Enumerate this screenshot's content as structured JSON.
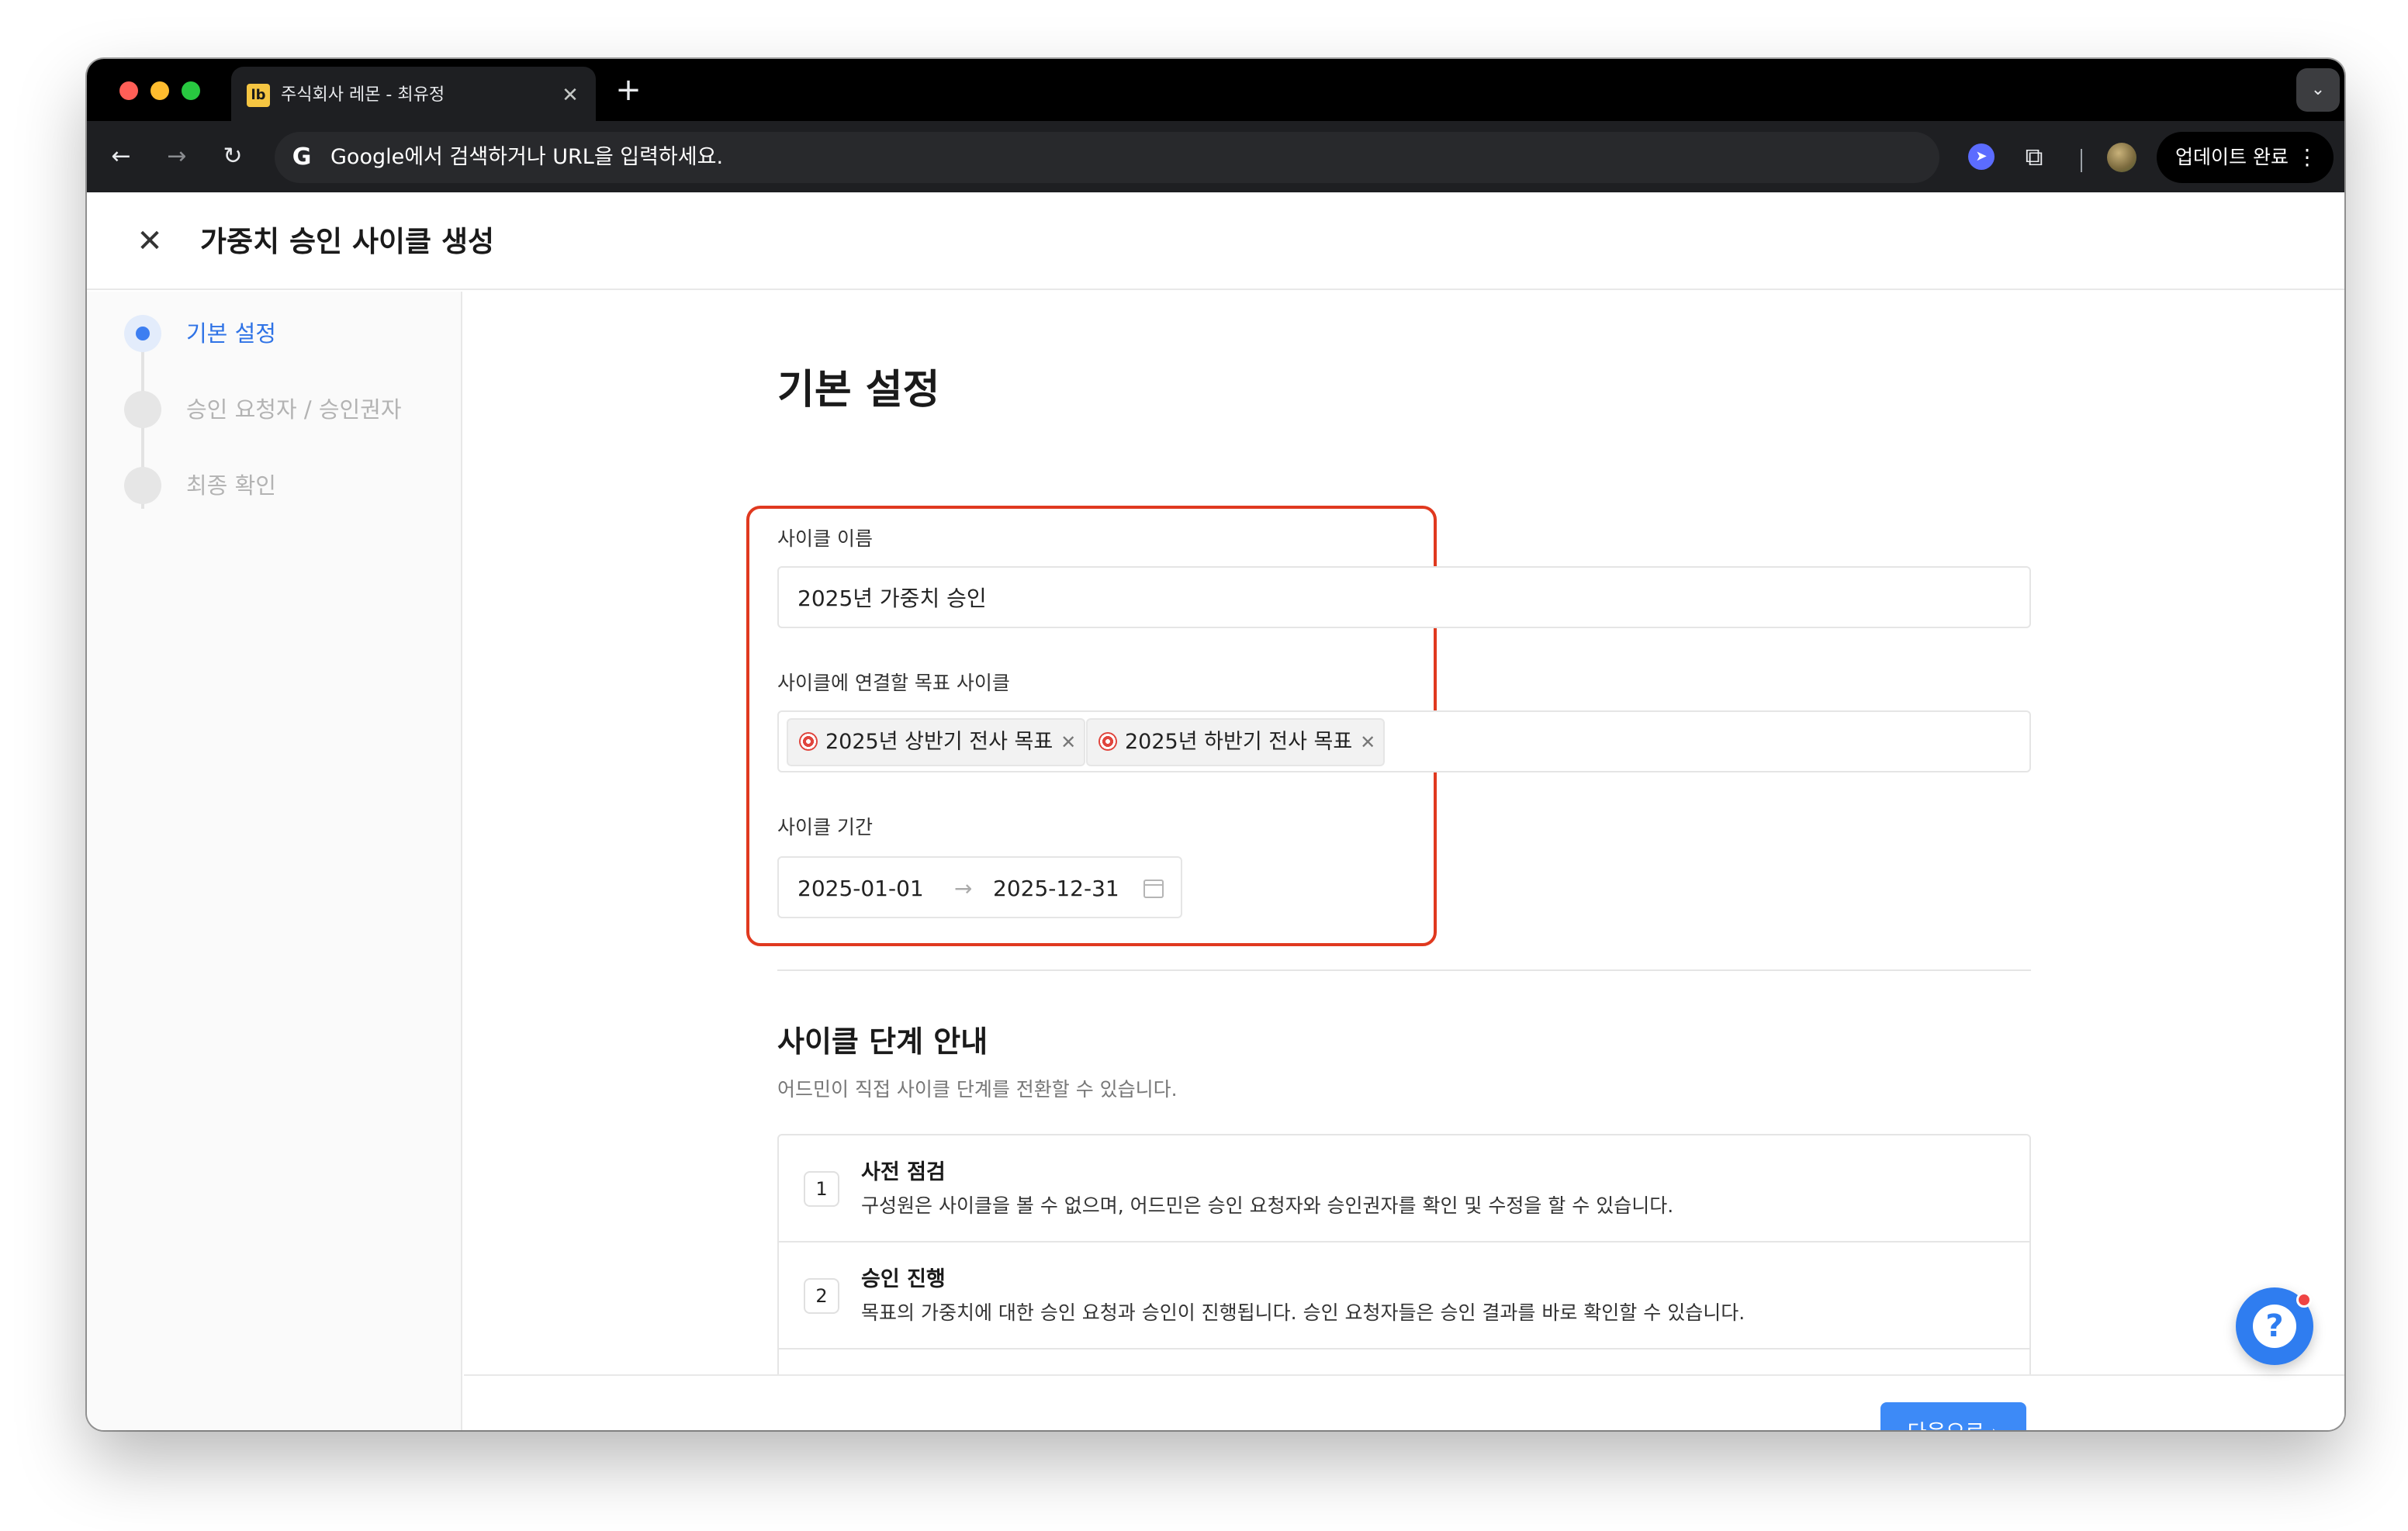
{
  "browser": {
    "tab_favicon": "lb",
    "tab_title": "주식회사 레몬 - 최유정",
    "omnibox_placeholder": "Google에서 검색하거나 URL을 입력하세요.",
    "update_label": "업데이트 완료",
    "icons": [
      "back-arrow-icon",
      "forward-arrow-icon",
      "reload-icon",
      "google-icon",
      "extension-icon",
      "puzzle-icon",
      "profile-avatar",
      "more-vert-icon",
      "tab-search-icon",
      "close-icon",
      "plus-icon"
    ]
  },
  "header": {
    "title": "가중치 승인 사이클 생성"
  },
  "sidebar": {
    "steps": [
      {
        "label": "기본 설정",
        "active": true
      },
      {
        "label": "승인 요청자 / 승인권자",
        "active": false
      },
      {
        "label": "최종 확인",
        "active": false
      }
    ]
  },
  "form": {
    "section_title": "기본 설정",
    "cycle_name_label": "사이클 이름",
    "cycle_name_value": "2025년 가중치 승인",
    "goal_cycle_label": "사이클에 연결할 목표 사이클",
    "goal_cycles": [
      "2025년 상반기 전사 목표",
      "2025년 하반기 전사 목표"
    ],
    "period_label": "사이클 기간",
    "period_start": "2025-01-01",
    "period_end": "2025-12-31",
    "period_arrow": "→"
  },
  "guide": {
    "title": "사이클 단계 안내",
    "description": "어드민이 직접 사이클 단계를 전환할 수 있습니다.",
    "stages": [
      {
        "num": "1",
        "title": "사전 점검",
        "desc": "구성원은 사이클을 볼 수 없으며, 어드민은 승인 요청자와 승인권자를 확인 및 수정을 할 수 있습니다."
      },
      {
        "num": "2",
        "title": "승인 진행",
        "desc": "목표의 가중치에 대한 승인 요청과 승인이 진행됩니다. 승인 요청자들은 승인 결과를 바로 확인할 수 있습니다."
      }
    ]
  },
  "footer": {
    "next_label": "다음으로 ›"
  },
  "colors": {
    "accent": "#3d8af7",
    "highlight": "#e0391f",
    "active_step": "#2f73e6"
  }
}
